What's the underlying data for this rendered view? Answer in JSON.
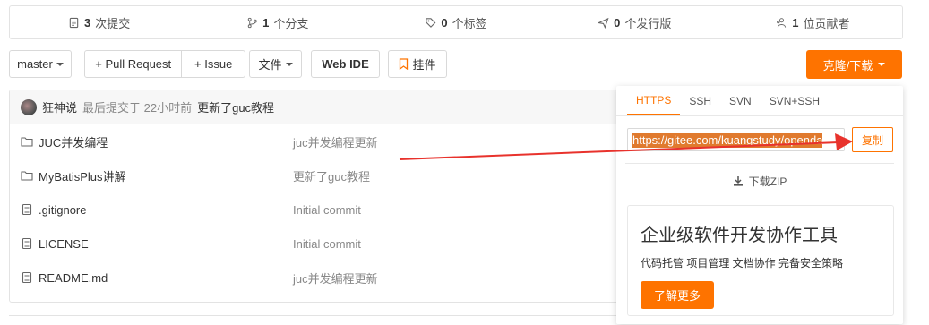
{
  "stats": [
    {
      "count": "3",
      "label": "次提交",
      "icon": "commit-icon"
    },
    {
      "count": "1",
      "label": "个分支",
      "icon": "branch-icon"
    },
    {
      "count": "0",
      "label": "个标签",
      "icon": "tag-icon"
    },
    {
      "count": "0",
      "label": "个发行版",
      "icon": "release-icon"
    },
    {
      "count": "1",
      "label": "位贡献者",
      "icon": "contributors-icon"
    }
  ],
  "toolbar": {
    "branch": "master",
    "pull_request": "+ Pull Request",
    "issue": "+ Issue",
    "file": "文件",
    "web_ide": "Web IDE",
    "widget": "挂件",
    "clone": "克隆/下载"
  },
  "commit": {
    "author": "狂神说",
    "time": "最后提交于 22小时前",
    "message": "更新了guc教程"
  },
  "files": [
    {
      "name": "JUC并发编程",
      "type": "folder",
      "commit": "juc并发编程更新"
    },
    {
      "name": "MyBatisPlus讲解",
      "type": "folder",
      "commit": "更新了guc教程"
    },
    {
      "name": ".gitignore",
      "type": "file",
      "commit": "Initial commit"
    },
    {
      "name": "LICENSE",
      "type": "file",
      "commit": "Initial commit"
    },
    {
      "name": "README.md",
      "type": "file",
      "commit": "juc并发编程更新"
    }
  ],
  "popup": {
    "tabs": [
      "HTTPS",
      "SSH",
      "SVN",
      "SVN+SSH"
    ],
    "active_tab": "HTTPS",
    "url": "https://gitee.com/kuangstudy/openda",
    "copy": "复制",
    "download": "下载ZIP",
    "ad_title": "企业级软件开发协作工具",
    "ad_sub": "代码托管 项目管理 文档协作 完备安全策略",
    "ad_button": "了解更多"
  },
  "colors": {
    "accent": "#fe7300",
    "arrow": "#e8322c"
  }
}
